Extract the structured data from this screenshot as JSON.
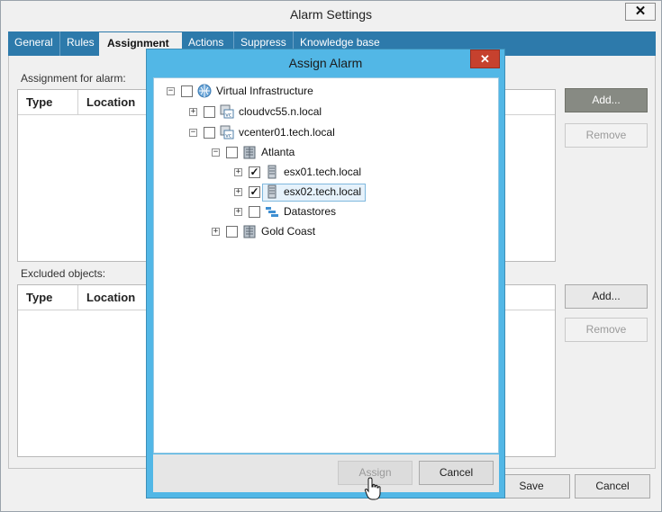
{
  "window": {
    "title": "Alarm Settings",
    "close_glyph": "✕"
  },
  "tabs": [
    {
      "label": "General"
    },
    {
      "label": "Rules"
    },
    {
      "label": "Assignment"
    },
    {
      "label": "Actions"
    },
    {
      "label": "Suppress"
    },
    {
      "label": "Knowledge base"
    }
  ],
  "assignment": {
    "section_label": "Assignment for alarm:",
    "columns": [
      "Type",
      "Location"
    ],
    "add_label": "Add...",
    "remove_label": "Remove"
  },
  "excluded": {
    "section_label": "Excluded objects:",
    "columns": [
      "Type",
      "Location"
    ],
    "add_label": "Add...",
    "remove_label": "Remove"
  },
  "footer": {
    "save_label": "Save",
    "cancel_label": "Cancel"
  },
  "modal": {
    "title": "Assign Alarm",
    "close_glyph": "✕",
    "tree": [
      {
        "label": "Virtual Infrastructure",
        "expanded": true,
        "checked": false,
        "icon": "infrastructure-icon"
      },
      {
        "label": "cloudvc55.n.local",
        "expanded": false,
        "checked": false,
        "icon": "vcenter-icon"
      },
      {
        "label": "vcenter01.tech.local",
        "expanded": true,
        "checked": false,
        "icon": "vcenter-icon"
      },
      {
        "label": "Atlanta",
        "expanded": true,
        "checked": false,
        "icon": "datacenter-icon"
      },
      {
        "label": "esx01.tech.local",
        "expanded": false,
        "checked": true,
        "icon": "host-icon"
      },
      {
        "label": "esx02.tech.local",
        "expanded": false,
        "checked": true,
        "icon": "host-icon",
        "selected": true
      },
      {
        "label": "Datastores",
        "expanded": false,
        "checked": false,
        "icon": "datastore-icon"
      },
      {
        "label": "Gold Coast",
        "expanded": false,
        "checked": false,
        "icon": "datacenter-icon"
      }
    ],
    "assign_label": "Assign",
    "cancel_label": "Cancel"
  },
  "colors": {
    "tab_bar": "#2d7aab",
    "modal_frame": "#52b7e6",
    "modal_close": "#c6412e"
  }
}
